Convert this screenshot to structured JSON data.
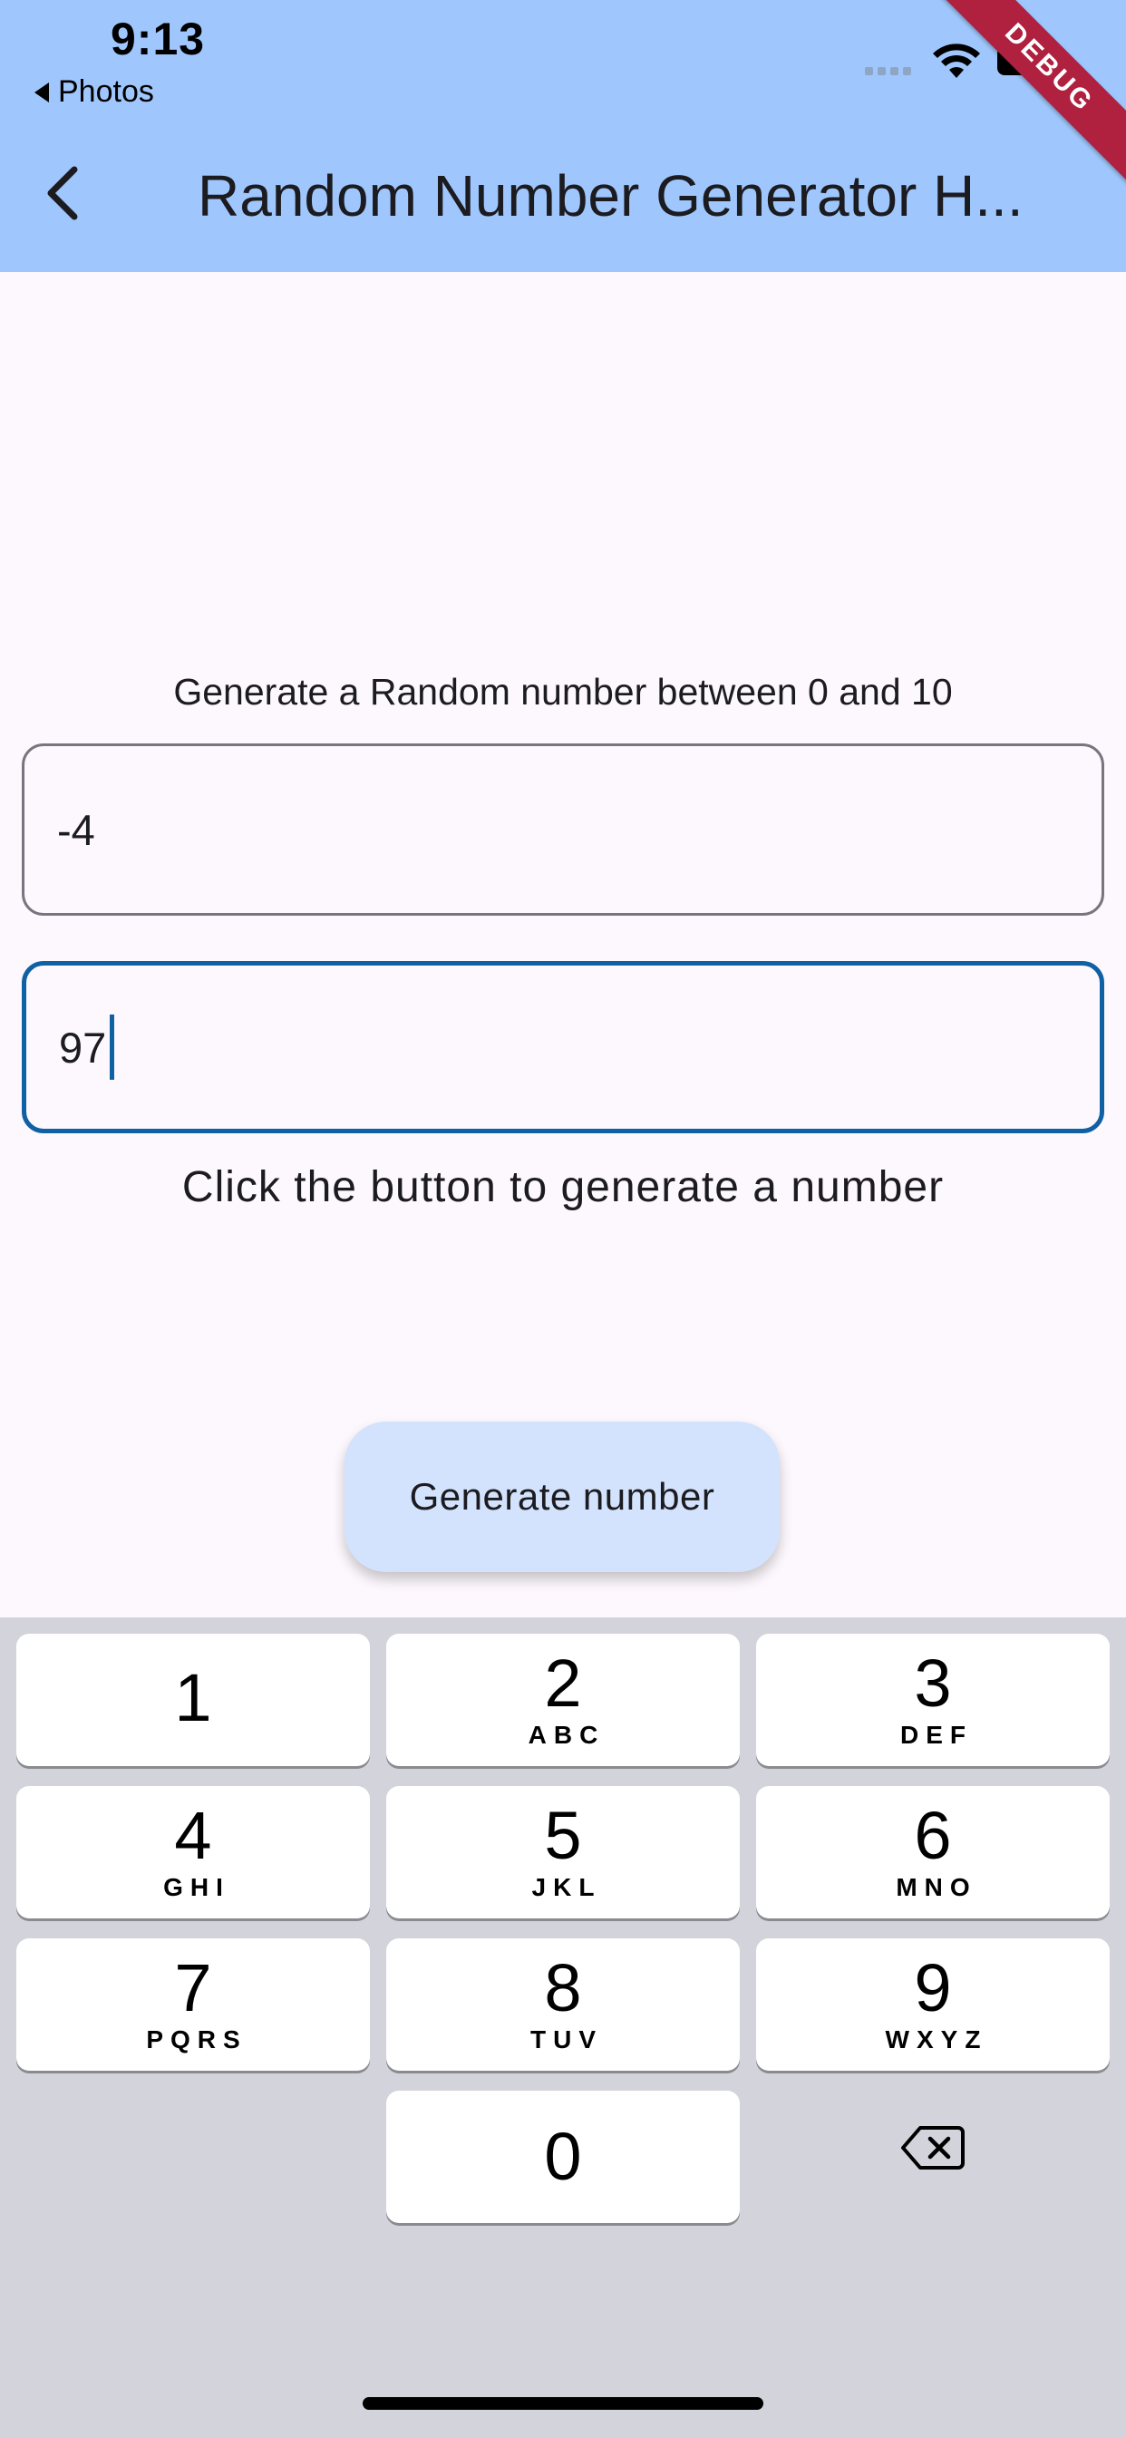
{
  "status_bar": {
    "time": "9:13",
    "back_app": "Photos",
    "debug_label": "DEBUG"
  },
  "app_bar": {
    "title": "Random Number Generator H...",
    "back_icon": "chevron-left-icon"
  },
  "form": {
    "range_label": "Generate a Random number between 0 and 10",
    "min_value": "-4",
    "max_value": "97",
    "result_text": "Click the button to generate a number",
    "generate_button": "Generate number"
  },
  "keyboard": {
    "keys": [
      {
        "num": "1",
        "letters": ""
      },
      {
        "num": "2",
        "letters": "ABC"
      },
      {
        "num": "3",
        "letters": "DEF"
      },
      {
        "num": "4",
        "letters": "GHI"
      },
      {
        "num": "5",
        "letters": "JKL"
      },
      {
        "num": "6",
        "letters": "MNO"
      },
      {
        "num": "7",
        "letters": "PQRS"
      },
      {
        "num": "8",
        "letters": "TUV"
      },
      {
        "num": "9",
        "letters": "WXYZ"
      },
      {
        "num": "0",
        "letters": ""
      }
    ],
    "delete_icon": "backspace-icon"
  },
  "colors": {
    "app_bar": "#9fc7fd",
    "focus_border": "#0f61a4",
    "button_bg": "#d3e3fd",
    "keyboard_bg": "#d3d4db",
    "debug_banner": "#b0203f"
  }
}
